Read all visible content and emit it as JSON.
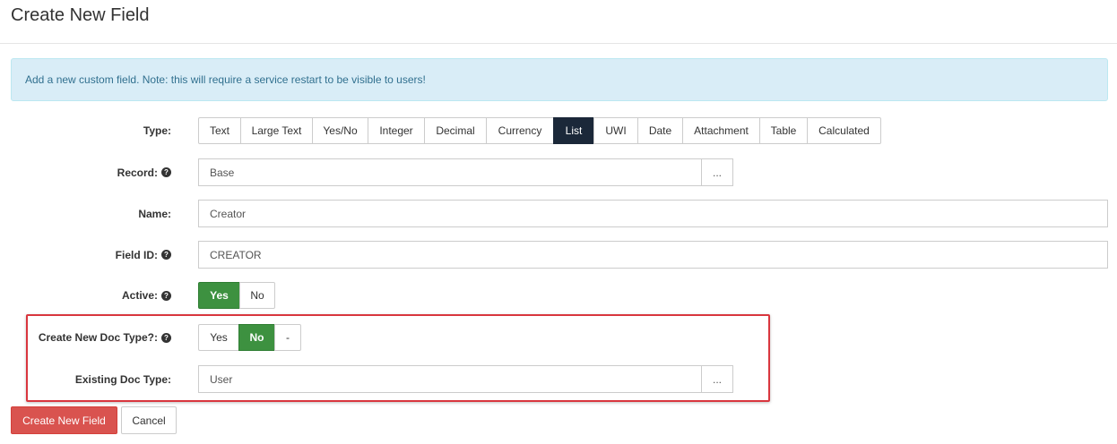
{
  "page": {
    "title": "Create New Field"
  },
  "alert": {
    "text": "Add a new custom field. Note: this will require a service restart to be visible to users!"
  },
  "form": {
    "type": {
      "label": "Type:",
      "options": [
        "Text",
        "Large Text",
        "Yes/No",
        "Integer",
        "Decimal",
        "Currency",
        "List",
        "UWI",
        "Date",
        "Attachment",
        "Table",
        "Calculated"
      ],
      "selected": "List"
    },
    "record": {
      "label": "Record:",
      "value": "Base",
      "browse_label": "..."
    },
    "name": {
      "label": "Name:",
      "value": "Creator"
    },
    "field_id": {
      "label": "Field ID:",
      "value": "CREATOR"
    },
    "active": {
      "label": "Active:",
      "options": [
        "Yes",
        "No"
      ],
      "selected": "Yes"
    },
    "create_new_doc_type": {
      "label": "Create New Doc Type?:",
      "options": [
        "Yes",
        "No",
        "-"
      ],
      "selected": "No"
    },
    "existing_doc_type": {
      "label": "Existing Doc Type:",
      "value": "User",
      "browse_label": "..."
    }
  },
  "actions": {
    "create_label": "Create New Field",
    "cancel_label": "Cancel"
  },
  "icons": {
    "help": "question-circle-icon"
  },
  "colors": {
    "selected_type": "#1b2839",
    "selected_toggle": "#3d9140",
    "primary_button": "#d9534f",
    "highlight_border": "#d9363e",
    "alert_bg": "#d9edf7"
  }
}
